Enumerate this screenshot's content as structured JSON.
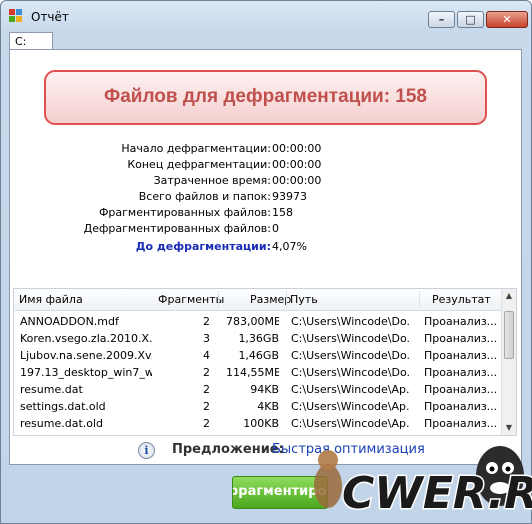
{
  "window": {
    "title": "Отчёт",
    "buttons": {
      "minimize": "–",
      "maximize": "□",
      "close": "✕"
    }
  },
  "tabs": [
    {
      "label": "C:"
    }
  ],
  "banner": {
    "text": "Файлов для дефрагментации: 158"
  },
  "stats": [
    {
      "label": "Начало дефрагментации:",
      "value": "00:00:00"
    },
    {
      "label": "Конец дефрагментации:",
      "value": "00:00:00"
    },
    {
      "label": "Затраченное время:",
      "value": "00:00:00"
    },
    {
      "label": "Всего файлов и папок:",
      "value": "93973"
    },
    {
      "label": "Фрагментированных файлов:",
      "value": "158"
    },
    {
      "label": "Дефрагментированных файлов:",
      "value": "0"
    },
    {
      "label": "До дефрагментации:",
      "value": "4,07%"
    }
  ],
  "file_list": {
    "columns": [
      "Имя файла",
      "Фрагменты",
      "Размер",
      "Путь",
      "Результат"
    ],
    "rows": [
      {
        "name": "ANNOADDON.mdf",
        "fragments": "2",
        "size": "783,00MB",
        "path": "C:\\Users\\Wincode\\Do...",
        "result": "Проанализ..."
      },
      {
        "name": "Koren.vsego.zla.2010.X...",
        "fragments": "3",
        "size": "1,36GB",
        "path": "C:\\Users\\Wincode\\Do...",
        "result": "Проанализ..."
      },
      {
        "name": "Ljubov.na.sene.2009.Xv...",
        "fragments": "4",
        "size": "1,46GB",
        "path": "C:\\Users\\Wincode\\Do...",
        "result": "Проанализ..."
      },
      {
        "name": "197.13_desktop_win7_w...",
        "fragments": "2",
        "size": "114,55MB",
        "path": "C:\\Users\\Wincode\\Do...",
        "result": "Проанализ..."
      },
      {
        "name": "resume.dat",
        "fragments": "2",
        "size": "94KB",
        "path": "C:\\Users\\Wincode\\Ap...",
        "result": "Проанализ..."
      },
      {
        "name": "settings.dat.old",
        "fragments": "2",
        "size": "4KB",
        "path": "C:\\Users\\Wincode\\Ap...",
        "result": "Проанализ..."
      },
      {
        "name": "resume.dat.old",
        "fragments": "2",
        "size": "100KB",
        "path": "C:\\Users\\Wincode\\Ap...",
        "result": "Проанализ..."
      }
    ]
  },
  "suggestion": {
    "label": "Предложение:",
    "link": "Быстрая оптимизация"
  },
  "defrag_button": {
    "label": "Дефрагментировать"
  },
  "watermark": {
    "text": "CWER.RU"
  },
  "colors": {
    "banner_text": "#c0504d",
    "link": "#1a3fb5",
    "button_green": "#4aa81d"
  }
}
